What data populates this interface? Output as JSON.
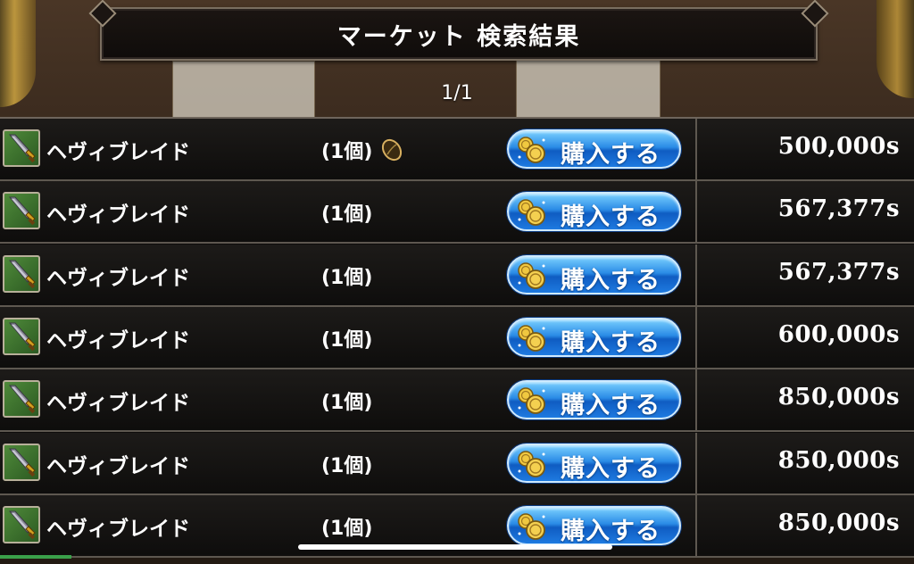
{
  "header": {
    "title": "マーケット 検索結果",
    "page": "1/1"
  },
  "listings": [
    {
      "name": "ヘヴィブレイド",
      "qty": "(1個)",
      "buy_label": "購入する",
      "price": "500,000s",
      "has_seed": true
    },
    {
      "name": "ヘヴィブレイド",
      "qty": "(1個)",
      "buy_label": "購入する",
      "price": "567,377s",
      "has_seed": false
    },
    {
      "name": "ヘヴィブレイド",
      "qty": "(1個)",
      "buy_label": "購入する",
      "price": "567,377s",
      "has_seed": false
    },
    {
      "name": "ヘヴィブレイド",
      "qty": "(1個)",
      "buy_label": "購入する",
      "price": "600,000s",
      "has_seed": false
    },
    {
      "name": "ヘヴィブレイド",
      "qty": "(1個)",
      "buy_label": "購入する",
      "price": "850,000s",
      "has_seed": false
    },
    {
      "name": "ヘヴィブレイド",
      "qty": "(1個)",
      "buy_label": "購入する",
      "price": "850,000s",
      "has_seed": false
    },
    {
      "name": "ヘヴィブレイド",
      "qty": "(1個)",
      "buy_label": "購入する",
      "price": "850,000s",
      "has_seed": false
    }
  ],
  "icons": {
    "item": "sword-icon",
    "coin": "coin-icon",
    "seed": "seed-icon"
  },
  "colors": {
    "button_blue": "#2a8be6",
    "item_icon_green": "#4f8a3a"
  }
}
